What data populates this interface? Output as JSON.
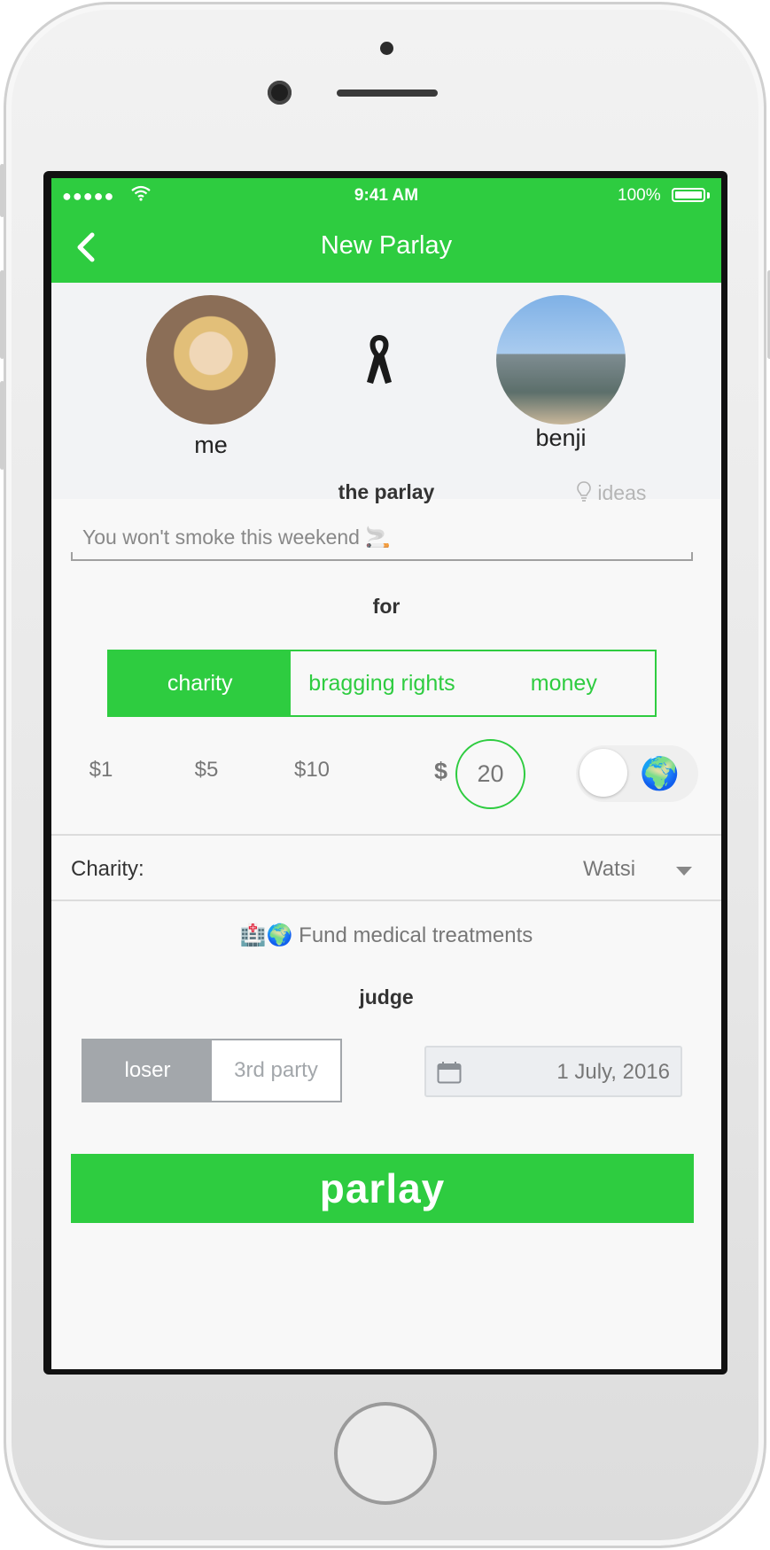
{
  "status_bar": {
    "signal": "●●●●●",
    "time": "9:41 AM",
    "battery": "100%"
  },
  "nav": {
    "title": "New Parlay"
  },
  "profiles": {
    "left_name": "me",
    "right_name": "benji"
  },
  "parlay": {
    "label": "the parlay",
    "ideas": "ideas",
    "input_value": "You won't smoke this weekend 🚬"
  },
  "stake": {
    "label": "for",
    "options": [
      "charity",
      "bragging rights",
      "money"
    ],
    "selected": "charity",
    "amounts": [
      "$1",
      "$5",
      "$10"
    ],
    "currency": "$",
    "custom_amount": "20",
    "toggle_icon": "🌍"
  },
  "charity": {
    "label": "Charity:",
    "selected": "Watsi",
    "description": "🏥🌍 Fund medical treatments"
  },
  "judge": {
    "label": "judge",
    "options": [
      "loser",
      "3rd party"
    ],
    "selected": "loser",
    "date": "1 July, 2016"
  },
  "submit": {
    "label": "parlay"
  },
  "colors": {
    "accent": "#2ecc40",
    "judge_gray": "#a3a7ab"
  }
}
